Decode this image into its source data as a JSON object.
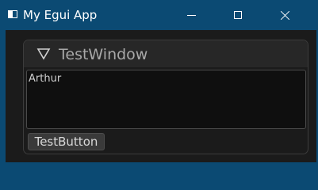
{
  "titlebar": {
    "app_title": "My Egui App",
    "app_icon": "app-window-icon",
    "controls": {
      "minimize_icon": "minimize-icon",
      "maximize_icon": "maximize-icon",
      "close_icon": "close-icon"
    }
  },
  "egui_window": {
    "title": "TestWindow",
    "collapse_icon": "collapse-triangle-icon",
    "text_edit": {
      "value": "Arthur"
    },
    "button_label": "TestButton"
  },
  "colors": {
    "titlebar_bg": "#0b4a73",
    "client_bg": "#1b1b1b",
    "window_header_bg": "#272727",
    "text_edit_bg": "#0f0f0f",
    "button_bg": "#3a3a3a"
  }
}
